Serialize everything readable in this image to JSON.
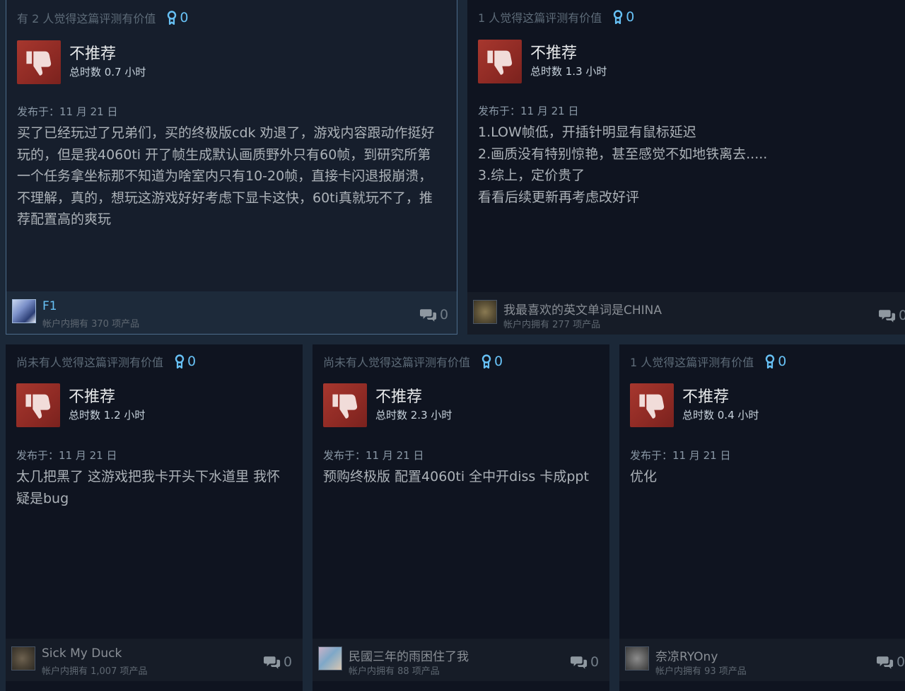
{
  "colors": {
    "accent": "#67c1f5",
    "thumb_red": "#a7372e",
    "page_bg": "#1b2838",
    "card_bg": "#0f1420"
  },
  "reviews": [
    {
      "helpful_text": "有 2 人觉得这篇评测有价值",
      "award_count": "0",
      "verdict": "不推荐",
      "hours": "总时数 0.7 小时",
      "posted": "发布于：11 月 21 日",
      "content_lines": [
        "买了已经玩过了兄弟们，买的终极版cdk 劝退了，游戏内容跟动作挺好",
        "玩的，但是我4060ti 开了帧生成默认画质野外只有60帧，到研究所第",
        "一个任务拿坐标那不知道为啥室内只有10-20帧，直接卡闪退报崩溃，",
        "不理解，真的，想玩这游戏好好考虑下显卡这快，60ti真就玩不了，推",
        "荐配置高的爽玩"
      ],
      "user_name": "F1",
      "user_products": "帐户内拥有 370 项产品",
      "comment_count": "0"
    },
    {
      "helpful_text": "1 人觉得这篇评测有价值",
      "award_count": "0",
      "verdict": "不推荐",
      "hours": "总时数 1.3 小时",
      "posted": "发布于：11 月 21 日",
      "content_lines": [
        "1.LOW帧低，开插针明显有鼠标延迟",
        "2.画质没有特别惊艳，甚至感觉不如地铁离去.....",
        "3.综上，定价贵了",
        "看看后续更新再考虑改好评"
      ],
      "user_name": "我最喜欢的英文单词是CHINA",
      "user_products": "帐户内拥有 277 项产品",
      "comment_count": "0"
    },
    {
      "helpful_text": "尚未有人觉得这篇评测有价值",
      "award_count": "0",
      "verdict": "不推荐",
      "hours": "总时数 1.2 小时",
      "posted": "发布于：11 月 21 日",
      "content_lines": [
        "太几把黑了 这游戏把我卡开头下水道里 我怀",
        "疑是bug"
      ],
      "user_name": "Sick My Duck",
      "user_products": "帐户内拥有 1,007 项产品",
      "comment_count": "0"
    },
    {
      "helpful_text": "尚未有人觉得这篇评测有价值",
      "award_count": "0",
      "verdict": "不推荐",
      "hours": "总时数 2.3 小时",
      "posted": "发布于：11 月 21 日",
      "content_lines": [
        "预购终极版 配置4060ti 全中开diss 卡成ppt"
      ],
      "user_name": "民國三年的雨困住了我",
      "user_products": "帐户内拥有 88 项产品",
      "comment_count": "0"
    },
    {
      "helpful_text": "1 人觉得这篇评测有价值",
      "award_count": "0",
      "verdict": "不推荐",
      "hours": "总时数 0.4 小时",
      "posted": "发布于：11 月 21 日",
      "content_lines": [
        "优化"
      ],
      "user_name": "奈凉RYOny",
      "user_products": "帐户内拥有 93 项产品",
      "comment_count": "0"
    }
  ]
}
